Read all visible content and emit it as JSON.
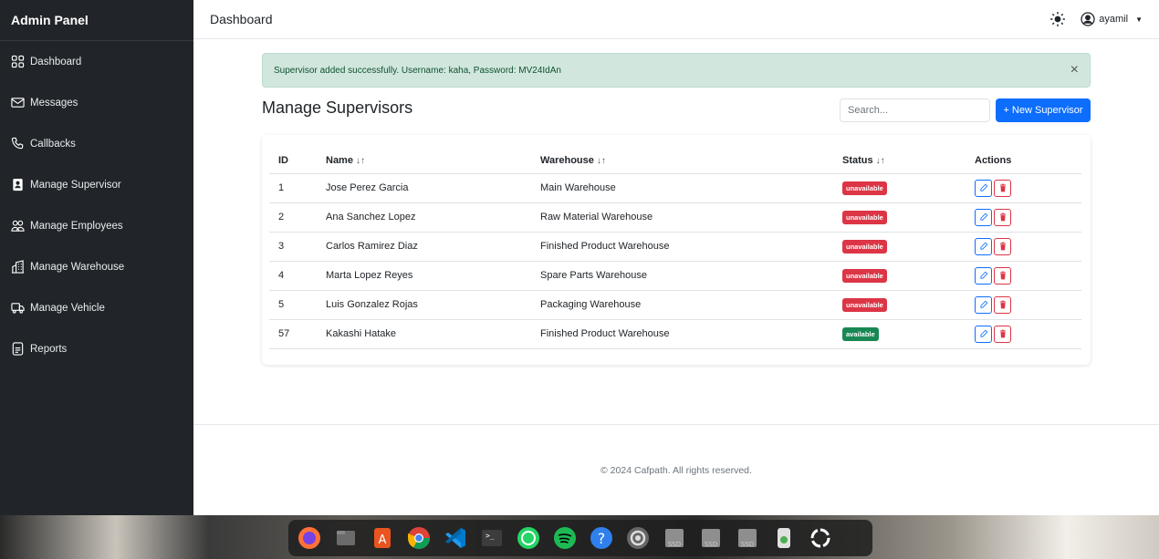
{
  "sidebar": {
    "brand": "Admin Panel",
    "items": [
      {
        "label": "Dashboard",
        "icon": "grid-icon"
      },
      {
        "label": "Messages",
        "icon": "envelope-icon"
      },
      {
        "label": "Callbacks",
        "icon": "phone-icon"
      },
      {
        "label": "Manage Supervisor",
        "icon": "badge-icon"
      },
      {
        "label": "Manage Employees",
        "icon": "people-icon"
      },
      {
        "label": "Manage Warehouse",
        "icon": "buildings-icon"
      },
      {
        "label": "Manage Vehicle",
        "icon": "truck-icon"
      },
      {
        "label": "Reports",
        "icon": "file-icon"
      }
    ]
  },
  "topbar": {
    "title": "Dashboard",
    "username": "ayamil"
  },
  "alert": {
    "message": "Supervisor added successfully. Username: kaha, Password: MV24IdAn",
    "close": "×"
  },
  "main": {
    "heading": "Manage Supervisors",
    "search_placeholder": "Search...",
    "new_button": "+ New Supervisor"
  },
  "table": {
    "columns": {
      "id": "ID",
      "name": "Name",
      "warehouse": "Warehouse",
      "status": "Status",
      "actions": "Actions"
    },
    "sort_glyph": "↓↑",
    "rows": [
      {
        "id": "1",
        "name": "Jose Perez Garcia",
        "warehouse": "Main Warehouse",
        "status": "unavailable"
      },
      {
        "id": "2",
        "name": "Ana Sanchez Lopez",
        "warehouse": "Raw Material Warehouse",
        "status": "unavailable"
      },
      {
        "id": "3",
        "name": "Carlos Ramirez Diaz",
        "warehouse": "Finished Product Warehouse",
        "status": "unavailable"
      },
      {
        "id": "4",
        "name": "Marta Lopez Reyes",
        "warehouse": "Spare Parts Warehouse",
        "status": "unavailable"
      },
      {
        "id": "5",
        "name": "Luis Gonzalez Rojas",
        "warehouse": "Packaging Warehouse",
        "status": "unavailable"
      },
      {
        "id": "57",
        "name": "Kakashi Hatake",
        "warehouse": "Finished Product Warehouse",
        "status": "available"
      }
    ]
  },
  "footer": {
    "text": "© 2024 Cafpath. All rights reserved."
  },
  "colors": {
    "sidebar_bg": "#212529",
    "primary": "#0d6efd",
    "danger": "#dc3545",
    "success": "#198754",
    "alert_bg": "#d1e7dd"
  },
  "dock": {
    "apps": [
      "firefox-icon",
      "files-icon",
      "app-center-icon",
      "chrome-icon",
      "vscode-icon",
      "terminal-icon",
      "whatsapp-icon",
      "spotify-icon",
      "help-icon",
      "settings-icon",
      "ssd-drive-icon",
      "ssd-drive-icon",
      "ssd-drive-icon",
      "trash-icon",
      "ubuntu-icon"
    ],
    "ssd_label": "SSD"
  }
}
